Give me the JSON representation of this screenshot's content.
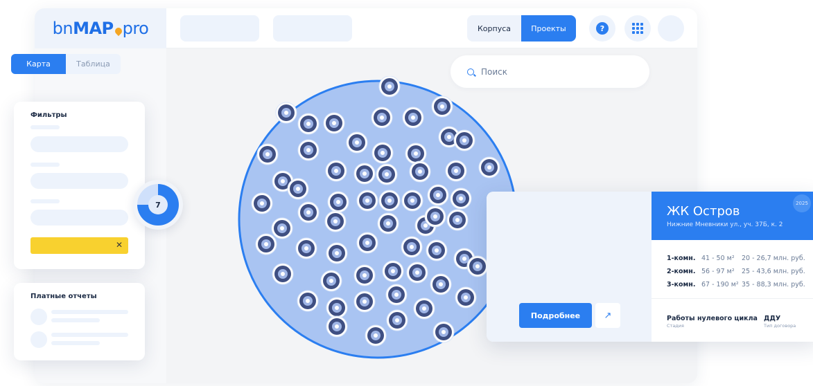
{
  "logo": {
    "prefix": "bn",
    "main": "MAP",
    "suffix": "pro"
  },
  "header": {
    "segment_buildings": "Корпуса",
    "segment_projects": "Проекты",
    "help_glyph": "?"
  },
  "view_tabs": {
    "map": "Карта",
    "table": "Таблица"
  },
  "search": {
    "placeholder": "Поиск",
    "icon": "search-icon"
  },
  "filters": {
    "title": "Фильтры",
    "clear_glyph": "✕"
  },
  "paid_reports": {
    "title": "Платные отчеты"
  },
  "cluster_badge": {
    "count": "7",
    "progress": 0.75
  },
  "project_card": {
    "year": "2025",
    "title": "ЖК Остров",
    "address": "Нижние Мневники ул., уч. 37Б, к. 2",
    "rooms": [
      {
        "type": "1-комн.",
        "area": "41 - 50 м²",
        "price": "20 - 26,7 млн. руб."
      },
      {
        "type": "2-комн.",
        "area": "56 - 97 м²",
        "price": "25 - 43,6 млн. руб."
      },
      {
        "type": "3-комн.",
        "area": "67 - 190 м²",
        "price": "35 - 88,3 млн. руб."
      }
    ],
    "stage_value": "Работы нулевого цикла",
    "stage_label": "Стадия",
    "contract_value": "ДДУ",
    "contract_label": "Тип договора",
    "more_button": "Подробнее",
    "external_icon": "external-link-icon"
  },
  "colors": {
    "accent": "#2b7ef0",
    "cluster_fill": "#a9c4f2",
    "highlight": "#f8d12f"
  }
}
